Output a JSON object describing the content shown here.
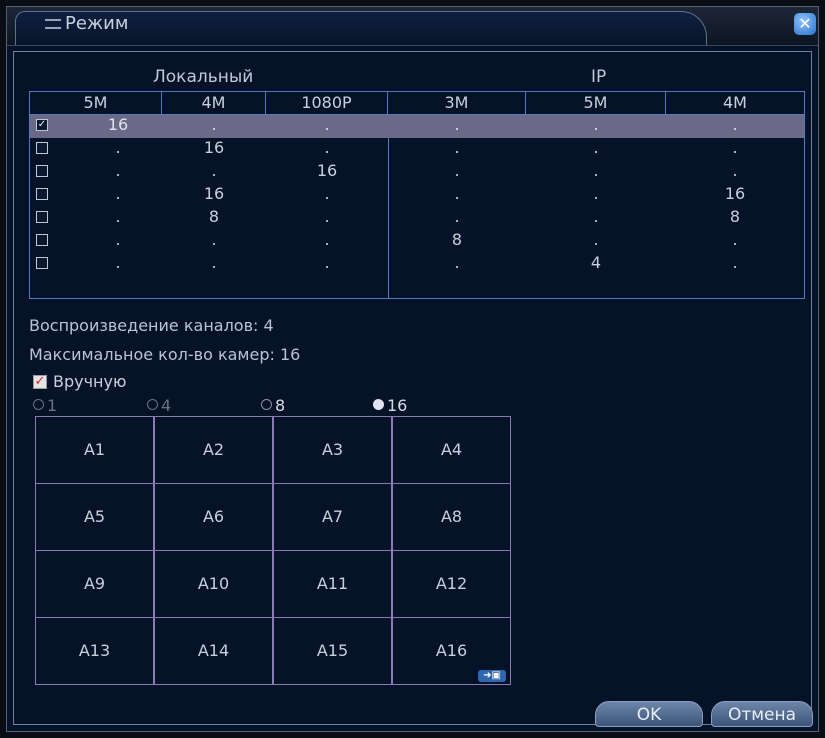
{
  "window": {
    "title": "Режим",
    "close_glyph": "✕"
  },
  "groups": {
    "local": "Локальный",
    "ip": "IP"
  },
  "headers": {
    "local": [
      "5M",
      "4M",
      "1080P"
    ],
    "ip": [
      "3M",
      "5M",
      "4M"
    ]
  },
  "rows": [
    {
      "checked": true,
      "selected": true,
      "local": [
        "16",
        ".",
        "."
      ],
      "ip": [
        ".",
        ".",
        "."
      ]
    },
    {
      "checked": false,
      "selected": false,
      "local": [
        ".",
        "16",
        "."
      ],
      "ip": [
        ".",
        ".",
        "."
      ]
    },
    {
      "checked": false,
      "selected": false,
      "local": [
        ".",
        ".",
        "16"
      ],
      "ip": [
        ".",
        ".",
        "."
      ]
    },
    {
      "checked": false,
      "selected": false,
      "local": [
        ".",
        "16",
        "."
      ],
      "ip": [
        ".",
        ".",
        "16"
      ]
    },
    {
      "checked": false,
      "selected": false,
      "local": [
        ".",
        "8",
        "."
      ],
      "ip": [
        ".",
        ".",
        "8"
      ]
    },
    {
      "checked": false,
      "selected": false,
      "local": [
        ".",
        ".",
        "."
      ],
      "ip": [
        "8",
        ".",
        "."
      ]
    },
    {
      "checked": false,
      "selected": false,
      "local": [
        ".",
        ".",
        "."
      ],
      "ip": [
        ".",
        "4",
        "."
      ]
    }
  ],
  "info": {
    "playback": "Воспроизведение каналов: 4",
    "max_cameras": "Максимальное кол-во камер: 16"
  },
  "manual": {
    "label": "Вручную",
    "checked": true
  },
  "radios": [
    {
      "label": "1",
      "selected": false,
      "enabled": false
    },
    {
      "label": "4",
      "selected": false,
      "enabled": false
    },
    {
      "label": "8",
      "selected": false,
      "enabled": true
    },
    {
      "label": "16",
      "selected": true,
      "enabled": true
    }
  ],
  "cameras": [
    "A1",
    "A2",
    "A3",
    "A4",
    "A5",
    "A6",
    "A7",
    "A8",
    "A9",
    "A10",
    "A11",
    "A12",
    "A13",
    "A14",
    "A15",
    "A16"
  ],
  "swap_icon": "swap-icon",
  "buttons": {
    "ok": "OK",
    "cancel": "Отмена"
  },
  "colors": {
    "background": "#061227",
    "table_border": "#4f7cc0",
    "selected_row": "#6a6a88",
    "grid_border": "#8a7bb6"
  }
}
